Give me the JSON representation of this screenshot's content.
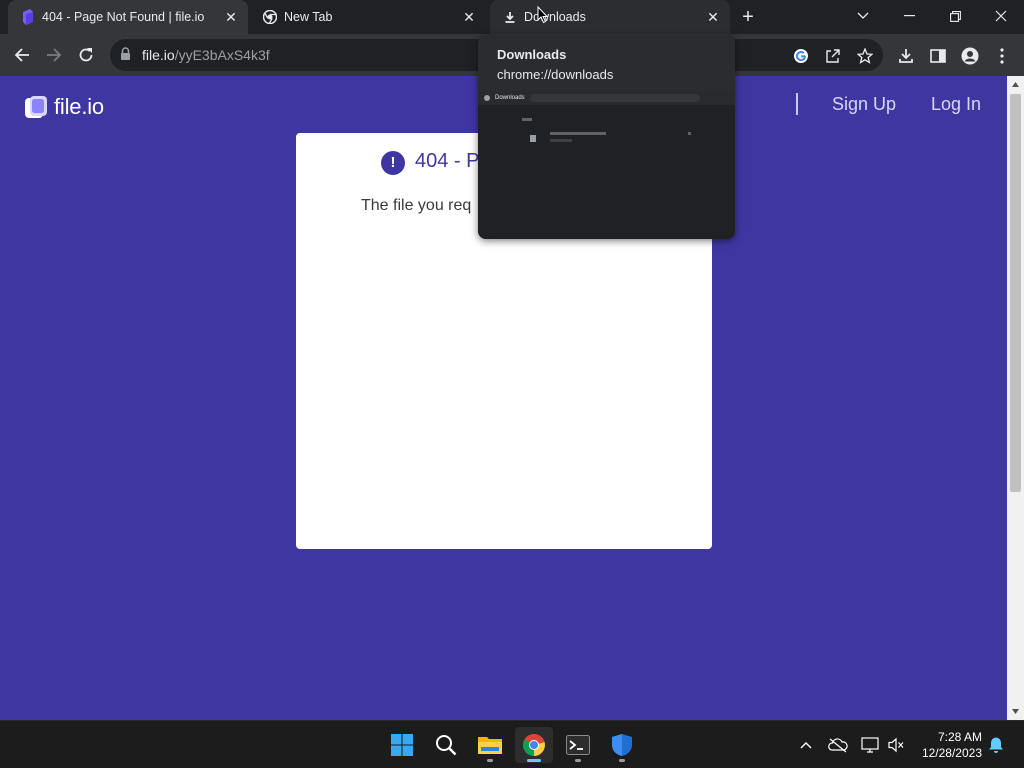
{
  "browser": {
    "tabs": [
      {
        "title": "404 - Page Not Found | file.io",
        "favicon": "fileio-logo-icon",
        "state": "active"
      },
      {
        "title": "New Tab",
        "favicon": "chrome-icon",
        "state": "inactive"
      },
      {
        "title": "Downloads",
        "favicon": "download-icon",
        "state": "hovered"
      }
    ],
    "close_glyph": "✕",
    "new_tab_glyph": "+",
    "address": {
      "host": "file.io",
      "path": "/yyE3bAxS4k3f"
    },
    "hover_card": {
      "title": "Downloads",
      "url": "chrome://downloads",
      "preview_title": "Downloads"
    }
  },
  "page": {
    "brand": "file.io",
    "nav": {
      "signup": "Sign Up",
      "login": "Log In"
    },
    "card": {
      "icon_glyph": "!",
      "heading": "404 - P",
      "message": "The file you req"
    },
    "colors": {
      "background": "#3e37a1",
      "card": "#ffffff",
      "accent": "#3e37a1"
    }
  },
  "taskbar": {
    "apps": [
      "start-icon",
      "search-icon",
      "file-explorer-icon",
      "chrome-icon",
      "terminal-icon",
      "defender-icon"
    ],
    "active_app": "chrome-icon",
    "clock": {
      "time": "7:28 AM",
      "date": "12/28/2023"
    }
  }
}
